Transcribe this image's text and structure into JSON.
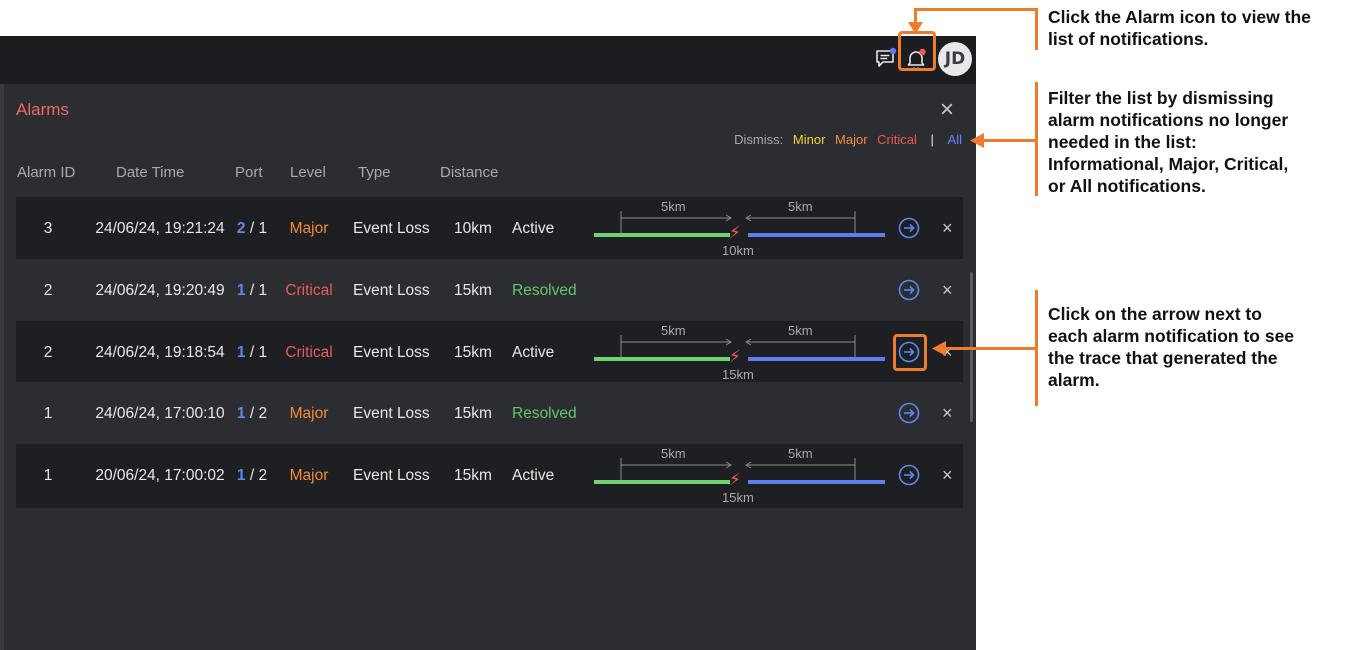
{
  "topbar": {
    "chat_icon": "chat-icon",
    "bell_icon": "bell-icon",
    "avatar_initials": "JD"
  },
  "panel": {
    "title": "Alarms",
    "close": "×",
    "dismiss": {
      "label": "Dismiss:",
      "minor": "Minor",
      "major": "Major",
      "critical": "Critical",
      "separator": "|",
      "all": "All"
    },
    "columns": [
      "Alarm ID",
      "Date Time",
      "Port",
      "Level",
      "Type",
      "Distance"
    ],
    "rows": [
      {
        "id": "3",
        "datetime": "24/06/24, 19:21:24",
        "port_a": "2",
        "port_sep": " / ",
        "port_b": "1",
        "level": "Major",
        "type": "Event Loss",
        "distance": "10km",
        "status": "Active",
        "trace": {
          "left": "5km",
          "right": "5km",
          "total": "10km"
        }
      },
      {
        "id": "2",
        "datetime": "24/06/24, 19:20:49",
        "port_a": "1",
        "port_sep": " / ",
        "port_b": "1",
        "level": "Critical",
        "type": "Event Loss",
        "distance": "15km",
        "status": "Resolved"
      },
      {
        "id": "2",
        "datetime": "24/06/24, 19:18:54",
        "port_a": "1",
        "port_sep": " / ",
        "port_b": "1",
        "level": "Critical",
        "type": "Event Loss",
        "distance": "15km",
        "status": "Active",
        "trace": {
          "left": "5km",
          "right": "5km",
          "total": "15km"
        }
      },
      {
        "id": "1",
        "datetime": "24/06/24, 17:00:10",
        "port_a": "1",
        "port_sep": " / ",
        "port_b": "2",
        "level": "Major",
        "type": "Event Loss",
        "distance": "15km",
        "status": "Resolved"
      },
      {
        "id": "1",
        "datetime": "20/06/24, 17:00:02",
        "port_a": "1",
        "port_sep": " / ",
        "port_b": "2",
        "level": "Major",
        "type": "Event Loss",
        "distance": "15km",
        "status": "Active",
        "trace": {
          "left": "5km",
          "right": "5km",
          "total": "15km"
        }
      }
    ],
    "row_close": "×"
  },
  "annotations": {
    "alarm_icon": "Click the Alarm icon to view the list of notifications.",
    "filter": "Filter the list by dismissing alarm notifications no longer needed in the list: Informational, Major, Critical, or All notifications.",
    "arrow": "Click on the arrow next to each alarm notification to see the trace that generated the alarm."
  },
  "colors": {
    "accent_annotation": "#ef7b2c",
    "major": "#f28b3c",
    "critical": "#ec5a52",
    "minor": "#f2d233",
    "all": "#5d88ee",
    "resolved": "#63c76a"
  }
}
